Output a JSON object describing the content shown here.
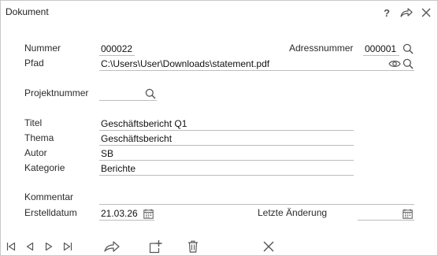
{
  "window": {
    "title": "Dokument",
    "help_label": "?"
  },
  "fields": {
    "nummer": {
      "label": "Nummer",
      "value": "000022"
    },
    "adressnummer": {
      "label": "Adressnummer",
      "value": "000001"
    },
    "pfad": {
      "label": "Pfad",
      "value": "C:\\Users\\User\\Downloads\\statement.pdf"
    },
    "projektnummer": {
      "label": "Projektnummer",
      "value": ""
    },
    "titel": {
      "label": "Titel",
      "value": "Geschäftsbericht Q1"
    },
    "thema": {
      "label": "Thema",
      "value": "Geschäftsbericht"
    },
    "autor": {
      "label": "Autor",
      "value": "SB"
    },
    "kategorie": {
      "label": "Kategorie",
      "value": "Berichte"
    },
    "kommentar": {
      "label": "Kommentar",
      "value": ""
    },
    "erstelldatum": {
      "label": "Erstelldatum",
      "value": "21.03.26"
    },
    "letzte_aenderung": {
      "label": "Letzte Änderung",
      "value": ""
    }
  },
  "icons": {
    "search": "search-icon",
    "eye": "eye-icon",
    "calendar": "calendar-icon",
    "first": "first-record-icon",
    "prev": "previous-record-icon",
    "next": "next-record-icon",
    "last": "last-record-icon",
    "share": "share-icon",
    "add": "add-document-icon",
    "delete": "trash-icon",
    "close": "close-icon"
  },
  "colors": {
    "icon": "#555555",
    "underline": "#bdbdbd",
    "border": "#c8c8c8"
  }
}
